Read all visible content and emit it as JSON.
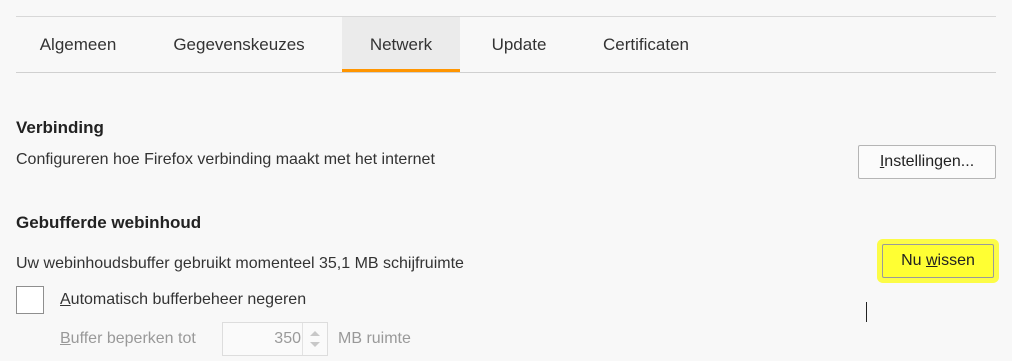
{
  "tabs": [
    {
      "label": "Algemeen",
      "active": false
    },
    {
      "label": "Gegevenskeuzes",
      "active": false
    },
    {
      "label": "Netwerk",
      "active": true
    },
    {
      "label": "Update",
      "active": false
    },
    {
      "label": "Certificaten",
      "active": false
    }
  ],
  "connection": {
    "title": "Verbinding",
    "description": "Configureren hoe Firefox verbinding maakt met het internet",
    "settings_button": {
      "label_pre": "",
      "label_ul": "I",
      "label_post": "nstellingen..."
    }
  },
  "cache": {
    "title": "Gebufferde webinhoud",
    "description": "Uw webinhoudsbuffer gebruikt momenteel 35,1 MB schijfruimte",
    "clear_button": {
      "label_pre": "Nu ",
      "label_ul": "w",
      "label_post": "issen"
    },
    "override_checkbox": {
      "label_pre": "",
      "label_ul": "A",
      "label_post": "utomatisch bufferbeheer negeren",
      "checked": false
    },
    "limit": {
      "label_pre": "",
      "label_ul": "B",
      "label_post": "uffer beperken tot",
      "value": "350",
      "unit": "MB ruimte"
    }
  },
  "colors": {
    "accent_tab": "#ff9500",
    "highlight": "#ffff33"
  }
}
